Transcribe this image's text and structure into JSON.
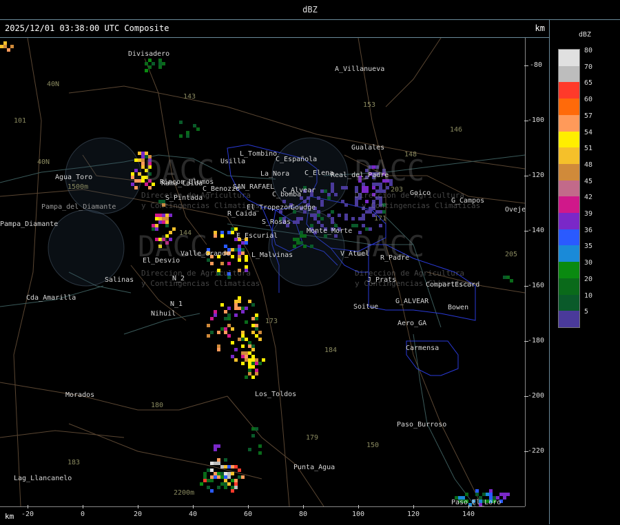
{
  "window": {
    "title": "dBZ"
  },
  "header": {
    "timestamp": "2025/12/01 03:38:00 UTC Composite",
    "unit_top": "km"
  },
  "legend": {
    "unit": "dBZ",
    "levels": [
      {
        "value": "80",
        "color": "#e0e0e0"
      },
      {
        "value": "70",
        "color": "#bdbdbd"
      },
      {
        "value": "65",
        "color": "#ff3a2a"
      },
      {
        "value": "60",
        "color": "#ff6a0a"
      },
      {
        "value": "57",
        "color": "#ff9a5a"
      },
      {
        "value": "54",
        "color": "#ffee00"
      },
      {
        "value": "51",
        "color": "#f5c02a"
      },
      {
        "value": "48",
        "color": "#d08a3a"
      },
      {
        "value": "45",
        "color": "#c26a8a"
      },
      {
        "value": "42",
        "color": "#d0188a"
      },
      {
        "value": "39",
        "color": "#7a28c8"
      },
      {
        "value": "36",
        "color": "#2a5aff"
      },
      {
        "value": "35",
        "color": "#1a8ad8"
      },
      {
        "value": "30",
        "color": "#0a8a10"
      },
      {
        "value": "20",
        "color": "#0a6a1a"
      },
      {
        "value": "10",
        "color": "#0a5a2a"
      },
      {
        "value": "5",
        "color": "#4a3a9a"
      }
    ]
  },
  "axes": {
    "y_labels": [
      "-80",
      "-100",
      "-120",
      "-140",
      "-160",
      "-180",
      "-200",
      "-220"
    ],
    "x_labels": [
      "-20",
      "0",
      "20",
      "40",
      "60",
      "80",
      "100",
      "120",
      "140"
    ],
    "x_unit": "km"
  },
  "places": [
    {
      "name": "Divisadero"
    },
    {
      "name": "A_Villanueva"
    },
    {
      "name": "40N"
    },
    {
      "name": "101"
    },
    {
      "name": "Agua_Toro"
    },
    {
      "name": "1500m"
    },
    {
      "name": "Pampa_Diamante"
    },
    {
      "name": "Usilla"
    },
    {
      "name": "L_Tombino"
    },
    {
      "name": "C_Española"
    },
    {
      "name": "Gualales"
    },
    {
      "name": "La_Nora"
    },
    {
      "name": "C_Elena"
    },
    {
      "name": "Real_del_Padre"
    },
    {
      "name": "C_Benozzo"
    },
    {
      "name": "SAN_RAFAEL"
    },
    {
      "name": "C_Alvear"
    },
    {
      "name": "Rama_Caida"
    },
    {
      "name": "C_bomba"
    },
    {
      "name": "El_Tropezon"
    },
    {
      "name": "Goudge"
    },
    {
      "name": "Goico"
    },
    {
      "name": "G_Campos"
    },
    {
      "name": "Ovejeria"
    },
    {
      "name": "S_Pintada"
    },
    {
      "name": "R_Caida"
    },
    {
      "name": "S_Rosas"
    },
    {
      "name": "Monte_Morte"
    },
    {
      "name": "E_Escurial"
    },
    {
      "name": "Valle_Grande"
    },
    {
      "name": "L_Malvinas"
    },
    {
      "name": "V_Atuel"
    },
    {
      "name": "R_Padre"
    },
    {
      "name": "El_Desvio"
    },
    {
      "name": "Salinas"
    },
    {
      "name": "N_2"
    },
    {
      "name": "J_Prats"
    },
    {
      "name": "CompartEscard"
    },
    {
      "name": "Cda_Amarilla"
    },
    {
      "name": "N_1"
    },
    {
      "name": "Nihuil"
    },
    {
      "name": "G_ALVEAR"
    },
    {
      "name": "Soitue"
    },
    {
      "name": "Bowen"
    },
    {
      "name": "Aero_GA"
    },
    {
      "name": "Carmensa"
    },
    {
      "name": "Los_Toldos"
    },
    {
      "name": "Morados"
    },
    {
      "name": "Paso_Burroso"
    },
    {
      "name": "Punta_Agua"
    },
    {
      "name": "Lag_Llancanelo"
    },
    {
      "name": "2200m"
    },
    {
      "name": "Paso_El_Loro"
    },
    {
      "name": "Pampa_del_Diamante"
    },
    {
      "name": "Rincon_Ulumos"
    },
    {
      "name": "Nihuil_1"
    }
  ],
  "roads": [
    "40N",
    "153",
    "146",
    "148",
    "143",
    "203",
    "171",
    "205",
    "173",
    "184",
    "180",
    "179",
    "150",
    "183",
    "144"
  ],
  "watermark": {
    "brand": "DACC",
    "line1": "Direccion de Agricultura",
    "line2": "y Contingencias Climaticas"
  }
}
